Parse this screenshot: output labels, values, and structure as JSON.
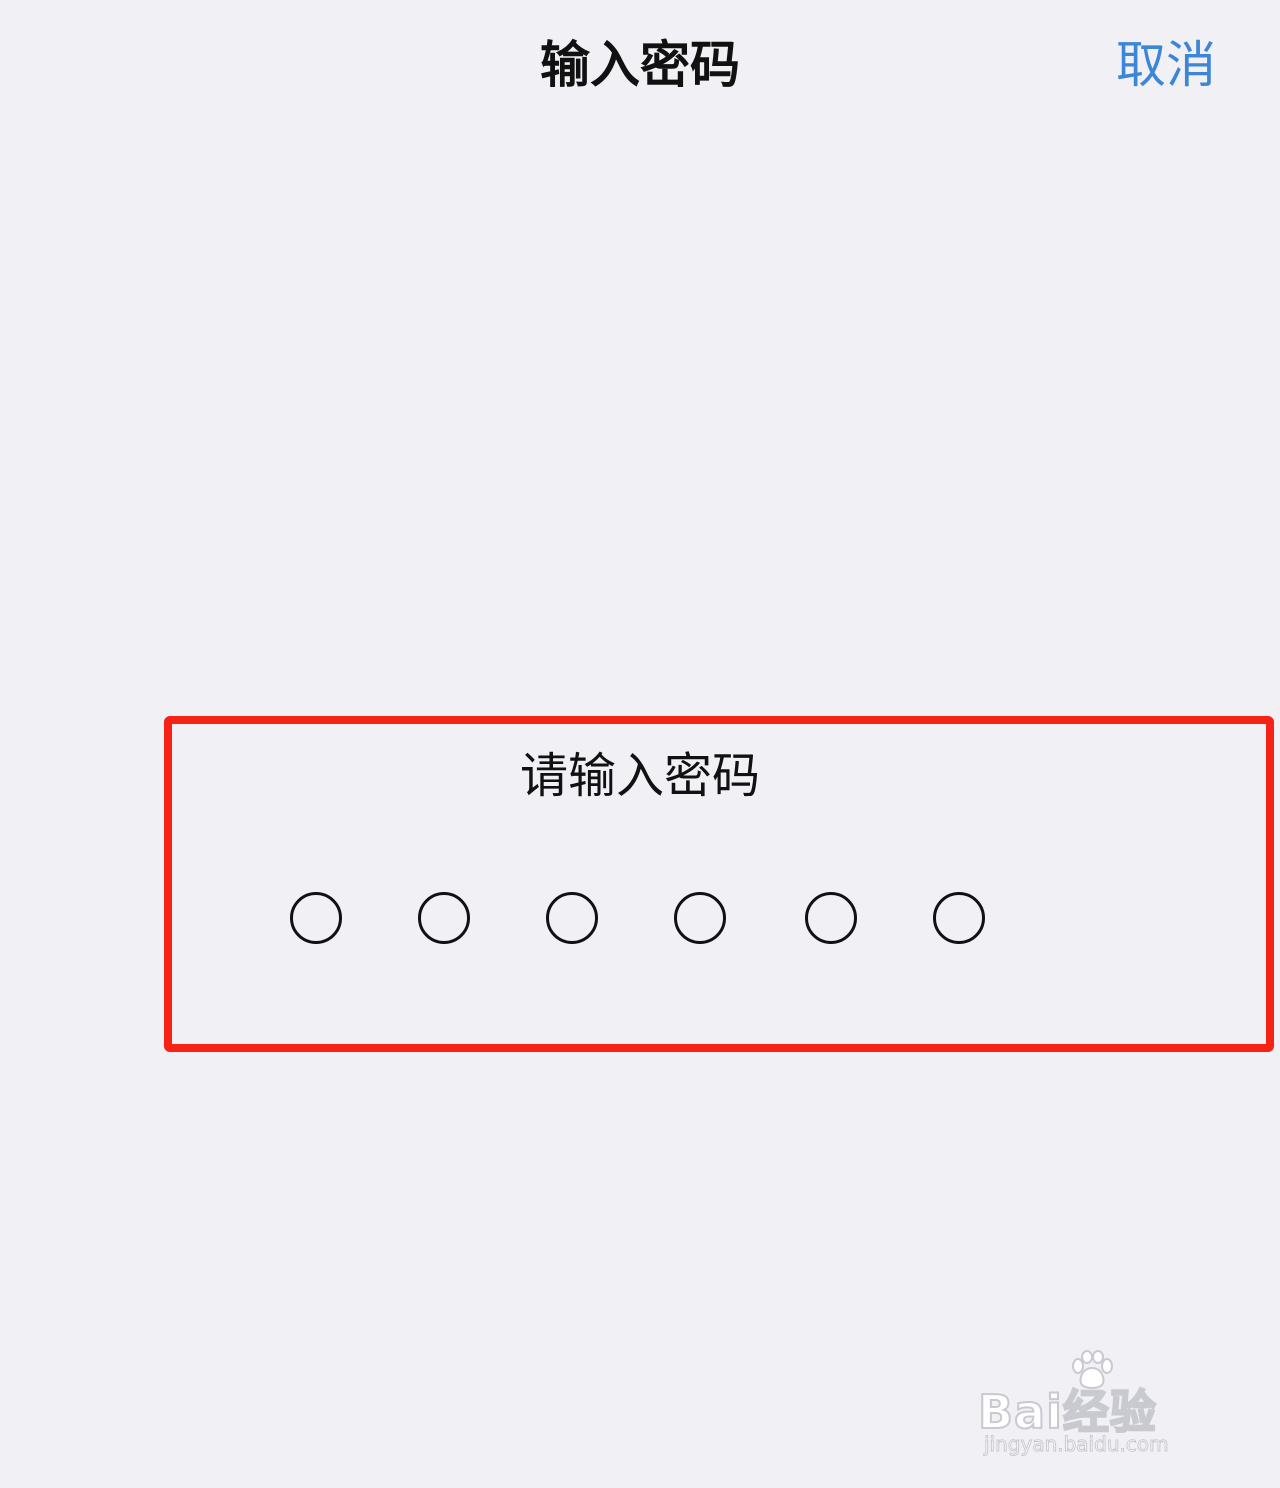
{
  "header": {
    "title": "输入密码",
    "cancel_label": "取消"
  },
  "prompt": {
    "text": "请输入密码"
  },
  "passcode": {
    "length": 6,
    "entered": 0
  },
  "watermark": {
    "brand": "Bai经验",
    "url": "jingyan.baidu.com"
  },
  "colors": {
    "background": "#f0f0f5",
    "accent": "#3b86d6",
    "highlight": "#f52215",
    "text": "#111111"
  }
}
